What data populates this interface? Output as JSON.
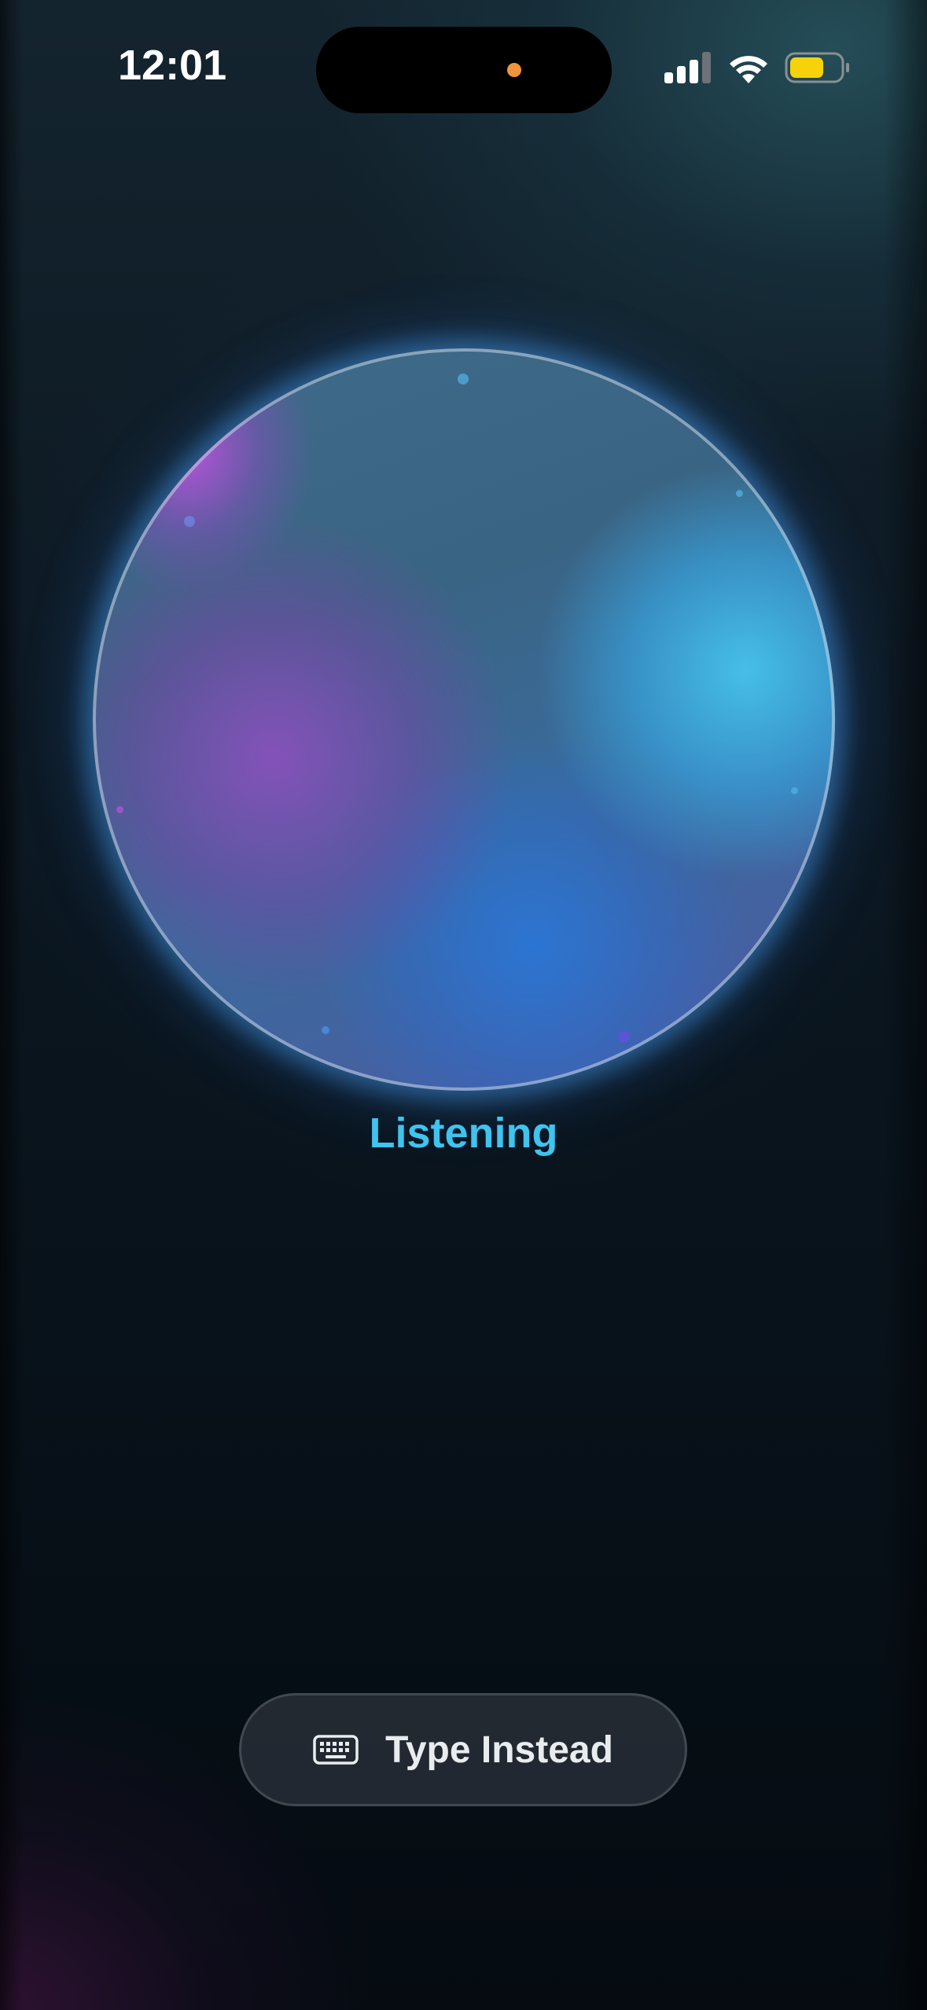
{
  "status_bar": {
    "time": "12:01",
    "icons": [
      "cellular-signal-icon",
      "wifi-icon",
      "battery-icon"
    ],
    "battery_color": "#f5d20a",
    "island_indicator_color": "#f0953a"
  },
  "voice": {
    "state_label": "Listening",
    "state_color": "#3fc3ef"
  },
  "actions": {
    "type_instead_label": "Type Instead",
    "type_instead_icon": "keyboard-icon"
  }
}
